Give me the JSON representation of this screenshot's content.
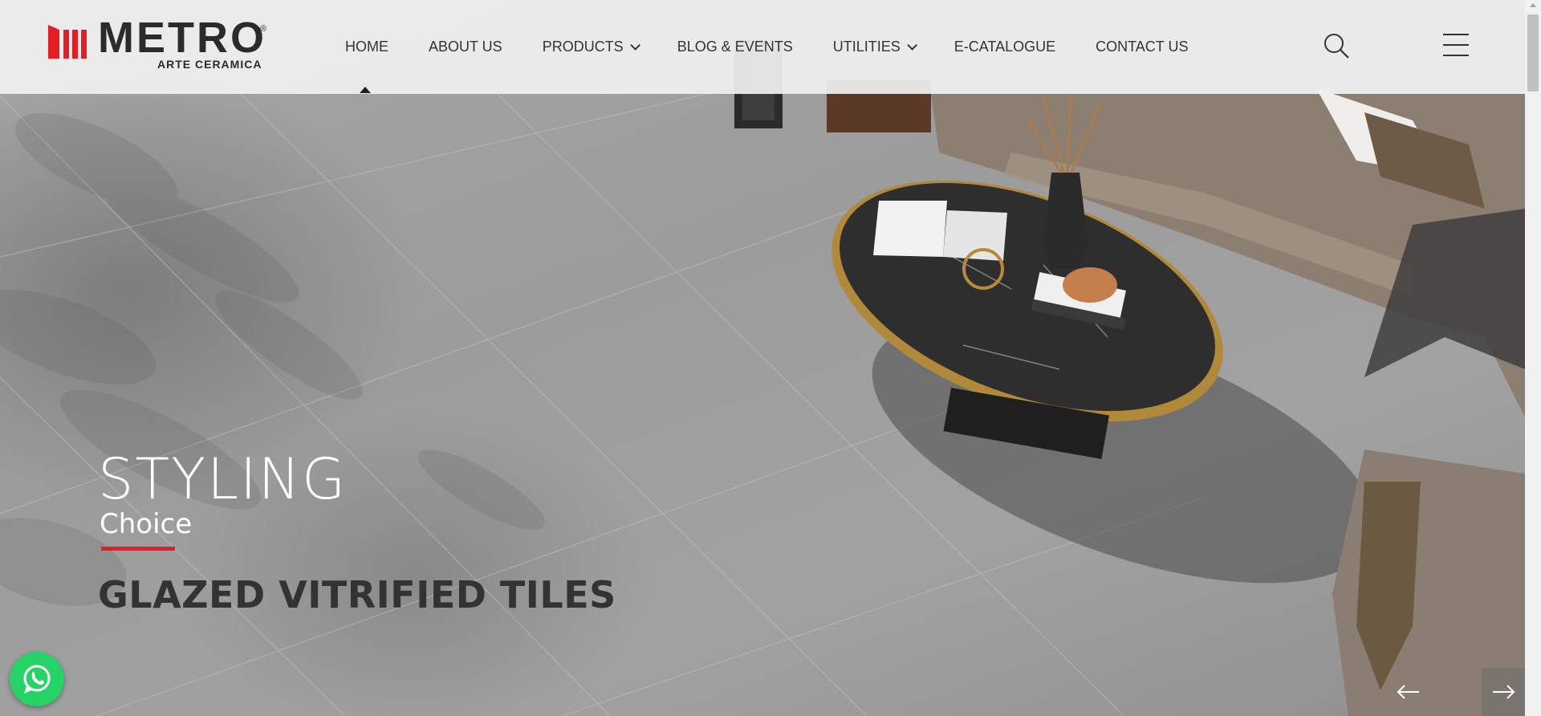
{
  "brand": {
    "name": "METRO",
    "registered_mark": "®",
    "subline": "ARTE CERAMICA",
    "color": "#e31e24"
  },
  "nav": {
    "items": [
      {
        "label": "HOME",
        "active": true,
        "has_dropdown": false
      },
      {
        "label": "ABOUT US",
        "active": false,
        "has_dropdown": false
      },
      {
        "label": "PRODUCTS",
        "active": false,
        "has_dropdown": true
      },
      {
        "label": "BLOG & EVENTS",
        "active": false,
        "has_dropdown": false
      },
      {
        "label": "UTILITIES",
        "active": false,
        "has_dropdown": true
      },
      {
        "label": "E-CATALOGUE",
        "active": false,
        "has_dropdown": false
      },
      {
        "label": "CONTACT US",
        "active": false,
        "has_dropdown": false
      }
    ],
    "search_icon": "search-icon",
    "menu_icon": "hamburger-menu-icon"
  },
  "hero": {
    "title": "STYLING",
    "subtitle": "Choice",
    "tagline": "GLAZED VITRIFIED TILES",
    "accent_color": "#e31e24"
  },
  "floating": {
    "whatsapp_icon": "whatsapp-icon",
    "whatsapp_color": "#25d366"
  },
  "slider": {
    "prev_icon": "arrow-left-icon",
    "next_icon": "arrow-right-icon"
  }
}
